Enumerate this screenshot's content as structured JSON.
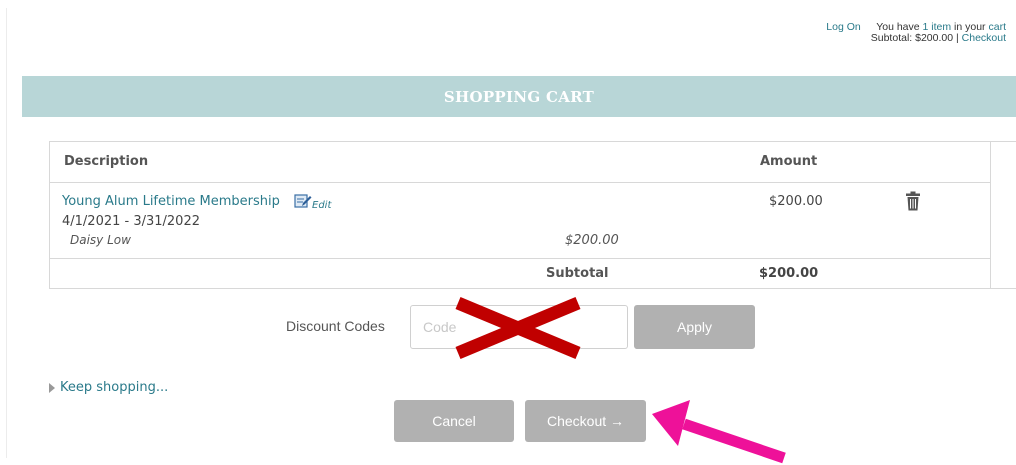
{
  "topbar": {
    "login_label": "Log On",
    "cart_prefix": "You have ",
    "item_count_label": "1 item",
    "cart_mid": " in your ",
    "cart_link": "cart",
    "subtotal_label": "Subtotal: $200.00",
    "separator": " | ",
    "checkout_link": "Checkout"
  },
  "header": {
    "title": "SHOPPING CART"
  },
  "table": {
    "columns": [
      "Description",
      "Amount"
    ],
    "items": [
      {
        "name": "Young Alum Lifetime Membership",
        "edit_label": "Edit",
        "dates": "4/1/2021 - 3/31/2022",
        "member": "Daisy Low",
        "member_amount": "$200.00",
        "amount": "$200.00"
      }
    ],
    "subtotal_label": "Subtotal",
    "subtotal_amount": "$200.00"
  },
  "discount": {
    "label": "Discount Codes",
    "placeholder": "Code",
    "apply_label": "Apply"
  },
  "keep_shopping_label": "Keep shopping...",
  "actions": {
    "cancel_label": "Cancel",
    "checkout_label": "Checkout →"
  },
  "colors": {
    "header_bg": "#b8d6d7",
    "link": "#2a7a8a",
    "button_bg": "#b1b1b1",
    "red_mark": "#c00000",
    "pink_arrow": "#ee1199"
  },
  "icons": {
    "edit": "edit-icon",
    "trash": "trash-icon",
    "caret": "caret-right-icon",
    "cross_mark": "red-x-icon",
    "arrow": "pink-arrow-icon"
  }
}
